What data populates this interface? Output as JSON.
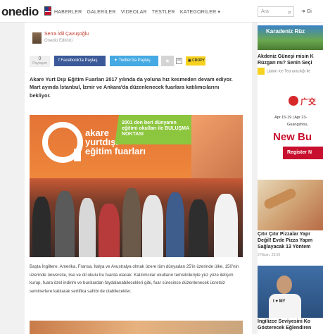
{
  "header": {
    "logo": "onedio",
    "nav": [
      "HABERLER",
      "GALERİLER",
      "VİDEOLAR",
      "TESTLER",
      "KATEGORİLER ▾"
    ],
    "search_placeholder": "Ara",
    "login": "Gi"
  },
  "article": {
    "author_name": "Serra İdil Çavuşoğlu",
    "author_role": "Onedio Editörü",
    "share": {
      "count": "0",
      "count_label": "Paylaşım",
      "facebook": "Facebook'ta Paylaş",
      "twitter": "Twitter'da Paylaş",
      "crop": "CROPY"
    },
    "lede": "Akare Yurt Dışı Eğitim Fuarları 2017 yılında da yoluna hız kesmeden devam ediyor. Mart ayında İstanbul, İzmir ve Ankara'da düzenlenecek fuarlara katılımcılarını bekliyor.",
    "hero": {
      "brand_a": "akare",
      "brand_b": "yurtdışı",
      "brand_c": "eğitim fuarları",
      "banner": "2001 den beri dünyanın eğitimi okulları ile BULUŞMA NOKTASI"
    },
    "body": "Başta İngiltere, Amerika, Fransa, İtalya ve Avustralya olmak üzere tüm dünyadan 25'in üzerinde ülke, 150'nin üzerinde üniversite, lise ve dil okulu bu fuarda olacak. Katılımcılar okulların temsilcileriyle yüz yüze iletişim kurup, fuara özel indirim ve burslardan faydalanabilecekleri gibi, fuar süresince düzenlenecek ücretsiz seminerlere katılarak sertifika sahibi de olabilecekler."
  },
  "sidebar": {
    "promo_image_text": "Karadeniz Rüz",
    "promo_title_1": "Akdeniz Güneşi misin K",
    "promo_title_2": "Rüzgarı mı? Senin Seçi",
    "sponsor": "Lipton Ice Tea aracılığı ile",
    "ad": {
      "logo_text": "广交",
      "dates": "Apr 15-19 | Apr 23-",
      "city": "Guangzhou,",
      "headline": "New Bu",
      "button": "Register N"
    },
    "card2_title_1": "Çıtır Çıtır Pizzalar Yapr",
    "card2_title_2": "Değil! Evde Pizza Yapm",
    "card2_title_3": "Sağlayacak 13 Yöntem",
    "card2_meta": "2 Nisan, 23:50",
    "card3_tee": "I ♥ MY",
    "card3_title_1": "İngilizce Seviyesini Ko",
    "card3_title_2": "Gösterecek Eğlendiren"
  },
  "colors": {
    "facebook": "#3b5998",
    "twitter": "#45a9e3",
    "accent_red": "#c8102e",
    "hero_orange": "#e47436"
  }
}
